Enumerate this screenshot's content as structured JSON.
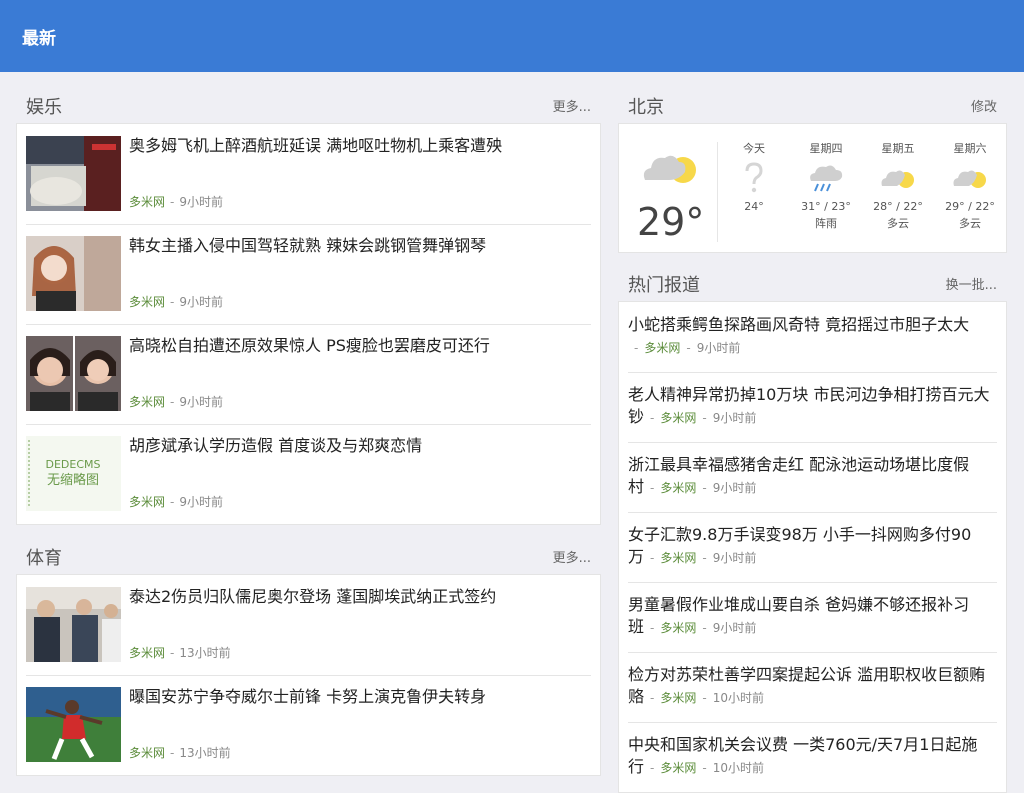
{
  "header": {
    "title": "最新"
  },
  "entertainment": {
    "title": "娱乐",
    "more": "更多...",
    "items": [
      {
        "title": "奥多姆飞机上醉酒航班延误 满地呕吐物机上乘客遭殃",
        "source": "多米网",
        "time": "9小时前"
      },
      {
        "title": "韩女主播入侵中国驾轻就熟 辣妹会跳钢管舞弹钢琴",
        "source": "多米网",
        "time": "9小时前"
      },
      {
        "title": "高晓松自拍遭还原效果惊人 PS瘦脸也罢磨皮可还行",
        "source": "多米网",
        "time": "9小时前"
      },
      {
        "title": "胡彦斌承认学历造假 首度谈及与郑爽恋情",
        "source": "多米网",
        "time": "9小时前",
        "thumb_text": [
          "DEDECMS",
          "无缩略图"
        ]
      }
    ]
  },
  "sports": {
    "title": "体育",
    "more": "更多...",
    "items": [
      {
        "title": "泰达2伤员归队儒尼奥尔登场 蓬国脚埃武纳正式签约",
        "source": "多米网",
        "time": "13小时前"
      },
      {
        "title": "曝国安苏宁争夺威尔士前锋 卡努上演克鲁伊夫转身",
        "source": "多米网",
        "time": "13小时前"
      }
    ]
  },
  "weather": {
    "city": "北京",
    "edit": "修改",
    "current_temp": "29°",
    "forecast": [
      {
        "day": "今天",
        "range": "24°",
        "desc": "",
        "icon": "unknown-icon"
      },
      {
        "day": "星期四",
        "range": "31° / 23°",
        "desc": "阵雨",
        "icon": "rain-icon"
      },
      {
        "day": "星期五",
        "range": "28° / 22°",
        "desc": "多云",
        "icon": "partly-cloudy-icon"
      },
      {
        "day": "星期六",
        "range": "29° / 22°",
        "desc": "多云",
        "icon": "partly-cloudy-icon"
      }
    ]
  },
  "hot": {
    "title": "热门报道",
    "refresh": "换一批...",
    "items": [
      {
        "title": "小蛇搭乘鳄鱼探路画风奇特 竟招摇过市胆子太大",
        "source": "多米网",
        "time": "9小时前"
      },
      {
        "title": "老人精神异常扔掉10万块 市民河边争相打捞百元大钞",
        "source": "多米网",
        "time": "9小时前"
      },
      {
        "title": "浙江最具幸福感猪舍走红 配泳池运动场堪比度假村",
        "source": "多米网",
        "time": "9小时前"
      },
      {
        "title": "女子汇款9.8万手误变98万 小手一抖网购多付90万",
        "source": "多米网",
        "time": "9小时前"
      },
      {
        "title": "男童暑假作业堆成山要自杀 爸妈嫌不够还报补习班",
        "source": "多米网",
        "time": "9小时前"
      },
      {
        "title": "检方对苏荣杜善学四案提起公诉 滥用职权收巨额贿赂",
        "source": "多米网",
        "time": "10小时前"
      },
      {
        "title": "中央和国家机关会议费 一类760元/天7月1日起施行",
        "source": "多米网",
        "time": "10小时前"
      }
    ]
  },
  "colors": {
    "accent": "#3a7bd5",
    "source": "#5b8c3a",
    "sun": "#f7d84a"
  }
}
